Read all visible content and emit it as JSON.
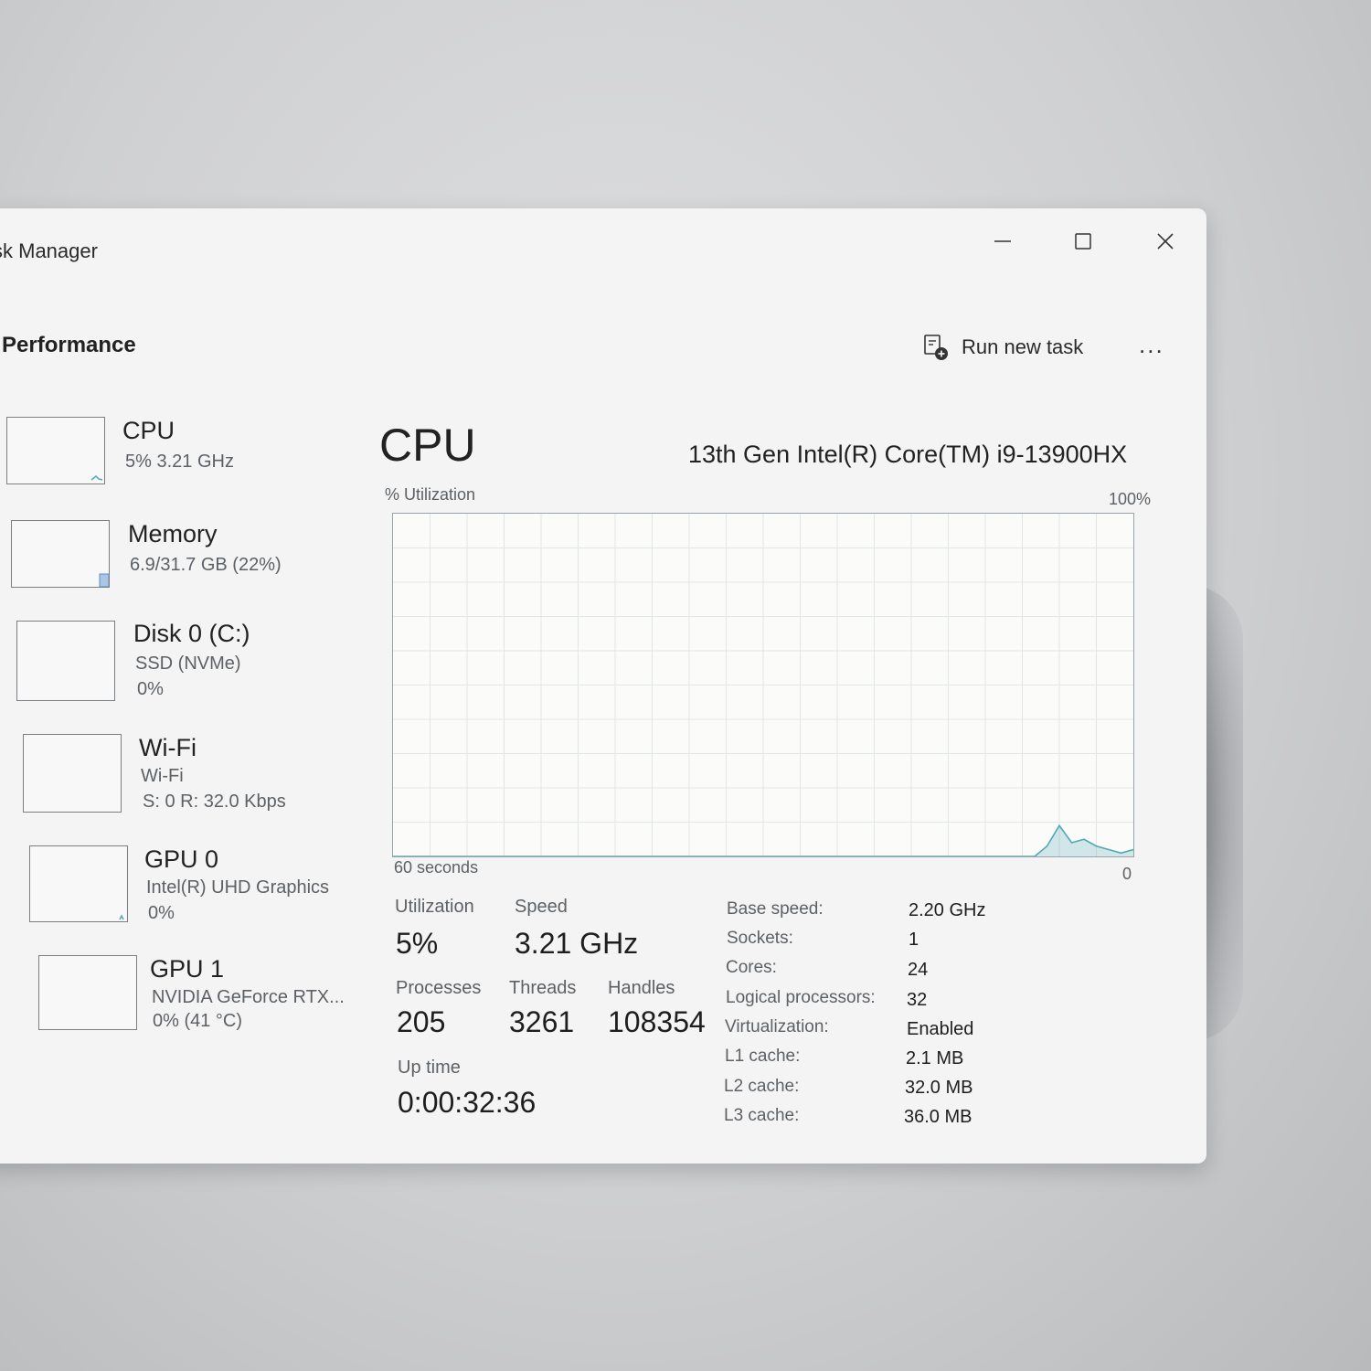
{
  "window": {
    "title": "sk Manager",
    "controls": {
      "minimize": "minimize-icon",
      "maximize": "maximize-icon",
      "close": "close-icon"
    }
  },
  "header": {
    "page_title": "Performance",
    "run_new_task": "Run new task",
    "more": "..."
  },
  "sidebar": {
    "items": [
      {
        "name": "CPU",
        "line1": "5%  3.21 GHz",
        "line2": ""
      },
      {
        "name": "Memory",
        "line1": "6.9/31.7 GB (22%)",
        "line2": ""
      },
      {
        "name": "Disk 0 (C:)",
        "line1": "SSD (NVMe)",
        "line2": "0%"
      },
      {
        "name": "Wi-Fi",
        "line1": "Wi-Fi",
        "line2": "S: 0 R: 32.0 Kbps"
      },
      {
        "name": "GPU 0",
        "line1": "Intel(R) UHD Graphics",
        "line2": "0%"
      },
      {
        "name": "GPU 1",
        "line1": "NVIDIA GeForce RTX...",
        "line2": "0%  (41 °C)"
      }
    ]
  },
  "main": {
    "title": "CPU",
    "model": "13th Gen Intel(R) Core(TM) i9-13900HX",
    "graph": {
      "y_label": "% Utilization",
      "y_max_label": "100%",
      "x_label": "60 seconds",
      "y_min_label": "0",
      "accent": "#4fa9b4",
      "utilization_percent": [
        0,
        0,
        0,
        0,
        0,
        0,
        0,
        0,
        0,
        0,
        0,
        0,
        0,
        0,
        0,
        0,
        0,
        0,
        0,
        0,
        0,
        0,
        0,
        0,
        0,
        0,
        0,
        0,
        0,
        0,
        0,
        0,
        0,
        0,
        0,
        0,
        0,
        0,
        0,
        0,
        0,
        0,
        0,
        0,
        0,
        0,
        0,
        0,
        0,
        0,
        0,
        0,
        0,
        3,
        9,
        4,
        5,
        3,
        2,
        1,
        2
      ]
    },
    "stats": {
      "utilization_label": "Utilization",
      "utilization": "5%",
      "speed_label": "Speed",
      "speed": "3.21 GHz",
      "processes_label": "Processes",
      "processes": "205",
      "threads_label": "Threads",
      "threads": "3261",
      "handles_label": "Handles",
      "handles": "108354",
      "uptime_label": "Up time",
      "uptime": "0:00:32:36"
    },
    "details": [
      {
        "key": "Base speed:",
        "value": "2.20 GHz"
      },
      {
        "key": "Sockets:",
        "value": "1"
      },
      {
        "key": "Cores:",
        "value": "24"
      },
      {
        "key": "Logical processors:",
        "value": "32"
      },
      {
        "key": "Virtualization:",
        "value": "Enabled"
      },
      {
        "key": "L1 cache:",
        "value": "2.1 MB"
      },
      {
        "key": "L2 cache:",
        "value": "32.0 MB"
      },
      {
        "key": "L3 cache:",
        "value": "36.0 MB"
      }
    ]
  }
}
